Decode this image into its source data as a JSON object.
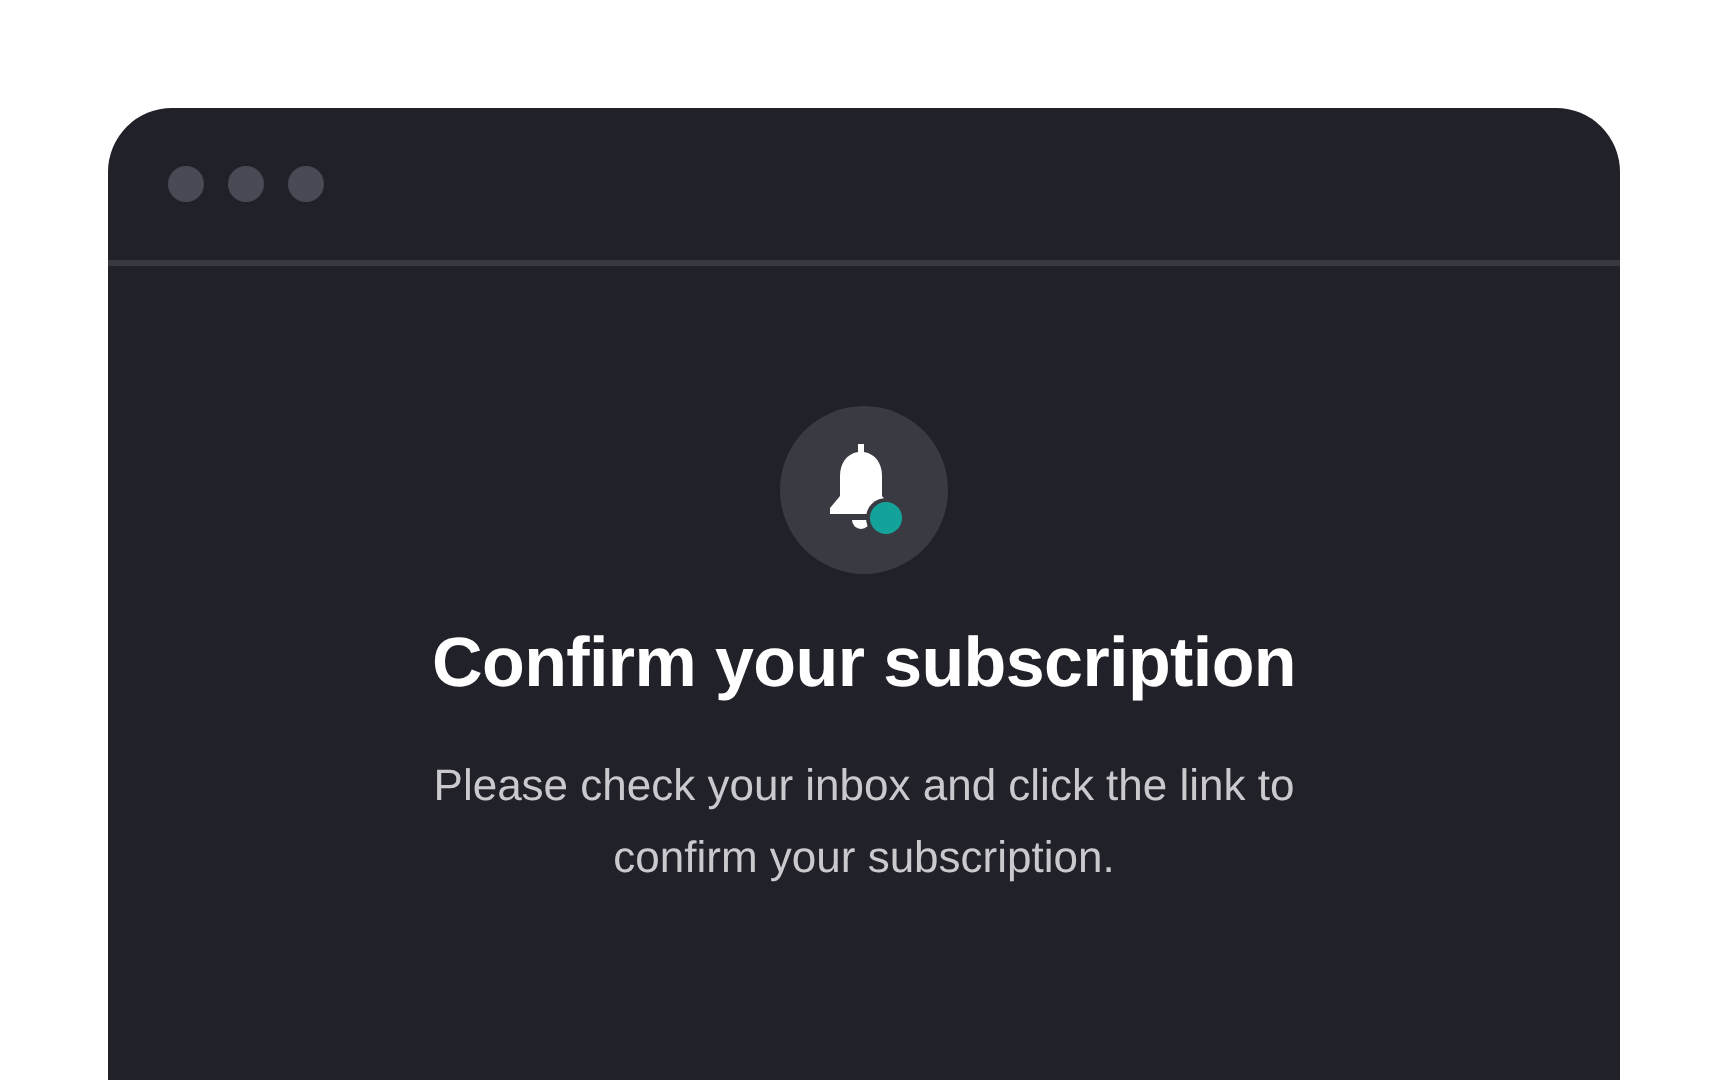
{
  "dialog": {
    "title": "Confirm your subscription",
    "message": "Please check your inbox and click the link to confirm your subscription."
  }
}
